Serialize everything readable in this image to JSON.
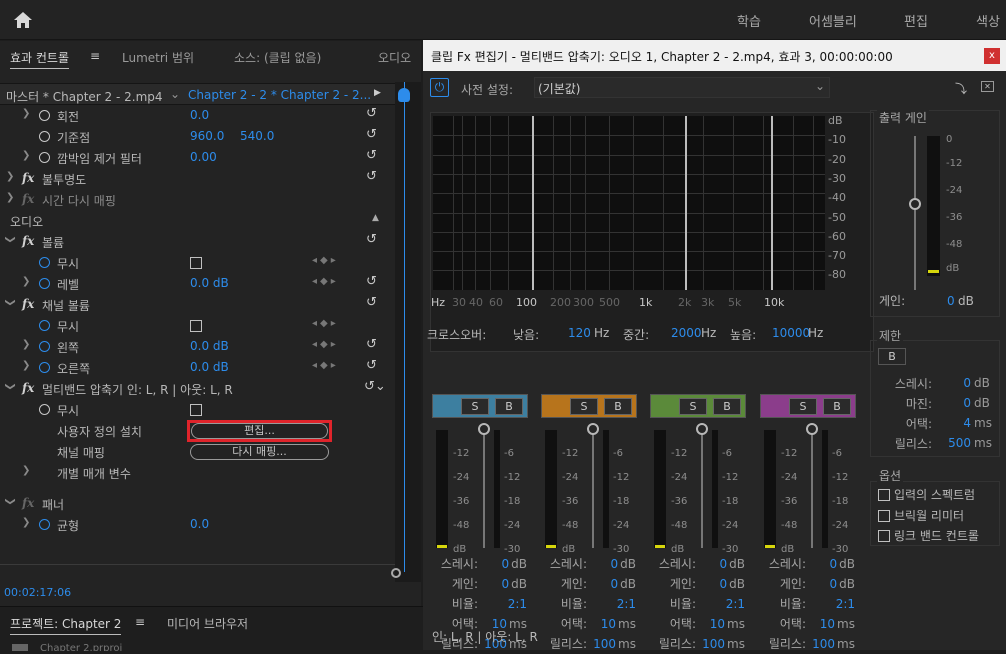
{
  "topbar": {
    "nav": [
      "학습",
      "어셈블리",
      "편집",
      "색상"
    ]
  },
  "left": {
    "tabs": {
      "effects": "효과 컨트롤",
      "menu": "≡",
      "lumetri": "Lumetri 범위",
      "source": "소스: (클립 없음)",
      "audio": "오디오"
    },
    "master": "마스터 * Chapter 2 - 2.mp4",
    "clip": "Chapter 2 - 2 * Chapter 2 - 2...",
    "rows": {
      "rotation": "회전",
      "rotation_val": "0.0",
      "anchor": "기준점",
      "anchor_x": "960.0",
      "anchor_y": "540.0",
      "flicker": "깜박임 제거 필터",
      "flicker_val": "0.00",
      "opacity": "불투명도",
      "timeremap": "시간 다시 매핑",
      "audio": "오디오",
      "volume": "볼륨",
      "bypass": "무시",
      "level": "레벨",
      "level_val": "0.0 dB",
      "chvol": "채널 볼륨",
      "left": "왼쪽",
      "left_val": "0.0 dB",
      "right": "오른쪽",
      "right_val": "0.0 dB",
      "mbc": "멀티밴드 압축기 인: L, R | 아웃: L, R",
      "custom": "사용자 정의 설치",
      "edit_btn": "편집...",
      "chmap": "채널 매핑",
      "remap_btn": "다시 매핑...",
      "params": "개별 매개 변수",
      "panner": "패너",
      "balance": "균형",
      "balance_val": "0.0"
    },
    "timecode": "00:02:17:06",
    "bottom": {
      "project": "프로젝트: Chapter 2",
      "menu": "≡",
      "media": "미디어 브라우저",
      "file": "Chapter 2.prproj"
    }
  },
  "dialog": {
    "title": "클립 Fx 편집기 - 멀티밴드 압축기: 오디오 1, Chapter 2 - 2.mp4, 효과 3, 00:00:00:00",
    "close": "x",
    "preset_label": "사전 설정:",
    "preset_value": "(기본값)",
    "db_ticks": [
      "dB",
      "-10",
      "-20",
      "-30",
      "-40",
      "-50",
      "-60",
      "-70",
      "-80"
    ],
    "hz_ticks": [
      "Hz",
      "30",
      "40",
      "60",
      "100",
      "200",
      "300",
      "500",
      "1k",
      "2k",
      "3k",
      "5k",
      "10k"
    ],
    "crossover": {
      "label": "크로스오버:",
      "low": "낮음:",
      "low_val": "120",
      "mid": "중간:",
      "mid_val": "2000",
      "high": "높음:",
      "high_val": "10000",
      "unit": "Hz"
    },
    "out_gain": {
      "title": "출력 게인",
      "ticks": [
        "0",
        "-12",
        "-24",
        "-36",
        "-48",
        "dB"
      ],
      "label": "게인:",
      "val": "0",
      "unit": "dB"
    },
    "limiter": {
      "title": "제한",
      "b": "B",
      "threshold": "스레시:",
      "threshold_val": "0",
      "margin": "마진:",
      "margin_val": "0",
      "attack": "어택:",
      "attack_val": "4",
      "release": "릴리스:",
      "release_val": "500",
      "db": "dB",
      "ms": "ms"
    },
    "options": {
      "title": "옵션",
      "spectrum": "입력의 스펙트럼",
      "wall": "브릭월 리미터",
      "link": "링크 밴드 컨트롤"
    },
    "band_labels": {
      "s": "S",
      "b": "B",
      "threshold": "스레시:",
      "gain": "게인:",
      "ratio": "비율:",
      "attack": "어택:",
      "release": "릴리스:",
      "db": "dB",
      "ms": "ms"
    },
    "meter_ticks_l": [
      "-12",
      "-24",
      "-36",
      "-48",
      "dB"
    ],
    "meter_ticks_r": [
      "-6",
      "-12",
      "-18",
      "-24",
      "-30"
    ],
    "bands": [
      {
        "color": "#3d7fa0",
        "threshold": "0",
        "gain": "0",
        "ratio": "2:1",
        "attack": "10",
        "release": "100"
      },
      {
        "color": "#b7741c",
        "threshold": "0",
        "gain": "0",
        "ratio": "2:1",
        "attack": "10",
        "release": "100"
      },
      {
        "color": "#5b8a3a",
        "threshold": "0",
        "gain": "0",
        "ratio": "2:1",
        "attack": "10",
        "release": "100"
      },
      {
        "color": "#8b3d8b",
        "threshold": "0",
        "gain": "0",
        "ratio": "2:1",
        "attack": "10",
        "release": "100"
      }
    ],
    "io": "인: L, R | 아웃: L, R"
  }
}
